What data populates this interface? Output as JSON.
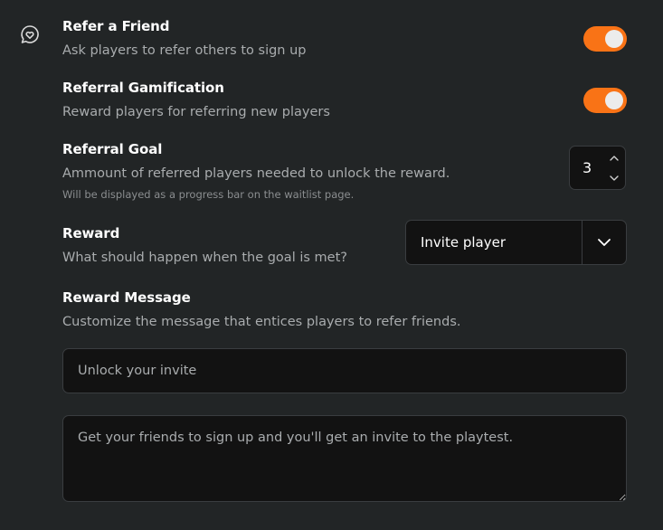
{
  "sections": {
    "refer_friend": {
      "title": "Refer a Friend",
      "description": "Ask players to refer others to sign up",
      "enabled": true
    },
    "gamification": {
      "title": "Referral Gamification",
      "description": "Reward players for referring new players",
      "enabled": true
    },
    "goal": {
      "title": "Referral Goal",
      "description": "Ammount of referred players needed to unlock the reward.",
      "hint": "Will be displayed as a progress bar on the waitlist page.",
      "value": "3"
    },
    "reward": {
      "title": "Reward",
      "description": "What should happen when the goal is met?",
      "selected": "Invite player"
    },
    "reward_message": {
      "title": "Reward Message",
      "description": "Customize the message that entices players to refer friends.",
      "headline_placeholder": "Unlock your invite",
      "body_placeholder": "Get your friends to sign up and you'll get an invite to the playtest."
    }
  },
  "colors": {
    "accent": "#f97316",
    "background": "#222526",
    "field_bg": "#121212"
  },
  "icons": {
    "section_icon": "heart-chat-icon",
    "stepper_up": "chevron-up-icon",
    "stepper_down": "chevron-down-icon",
    "select_chevron": "chevron-down-icon"
  }
}
